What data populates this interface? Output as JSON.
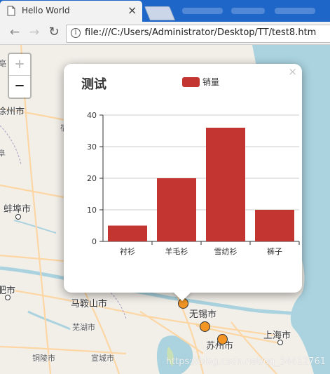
{
  "browser": {
    "tab_title": "Hello World",
    "close_glyph": "×",
    "url": "file:///C:/Users/Administrator/Desktop/TT/test8.htm"
  },
  "map": {
    "zoom_in": "+",
    "zoom_out": "−",
    "labels": {
      "xuzhou": "徐州市",
      "bengbu": "蚌埠市",
      "hefei": "肥市",
      "maanshan": "马鞍山市",
      "wuhu": "芜湖市",
      "wuxi": "无锡市",
      "suzhou": "苏州市",
      "shanghai": "上海市",
      "xuancheng": "宣城市",
      "tongling": "铜陵市",
      "su": "宿",
      "fu": "阜",
      "hao": "亳"
    },
    "watermark": "https://blog.csdn.net/qq_34412761"
  },
  "popup": {
    "close_glyph": "×"
  },
  "chart_data": {
    "type": "bar",
    "title": "测试",
    "legend": [
      "销量"
    ],
    "legend_position": "top-center",
    "categories": [
      "衬衫",
      "羊毛衫",
      "雪纺衫",
      "裤子"
    ],
    "series": [
      {
        "name": "销量",
        "values": [
          5,
          20,
          36,
          10
        ]
      }
    ],
    "ylim": [
      0,
      40
    ],
    "yticks": [
      0,
      10,
      20,
      30,
      40
    ],
    "grid": true,
    "colors": {
      "bar": "#c23531",
      "title": "#333333",
      "axis": "#333333",
      "grid": "#cccccc"
    }
  }
}
